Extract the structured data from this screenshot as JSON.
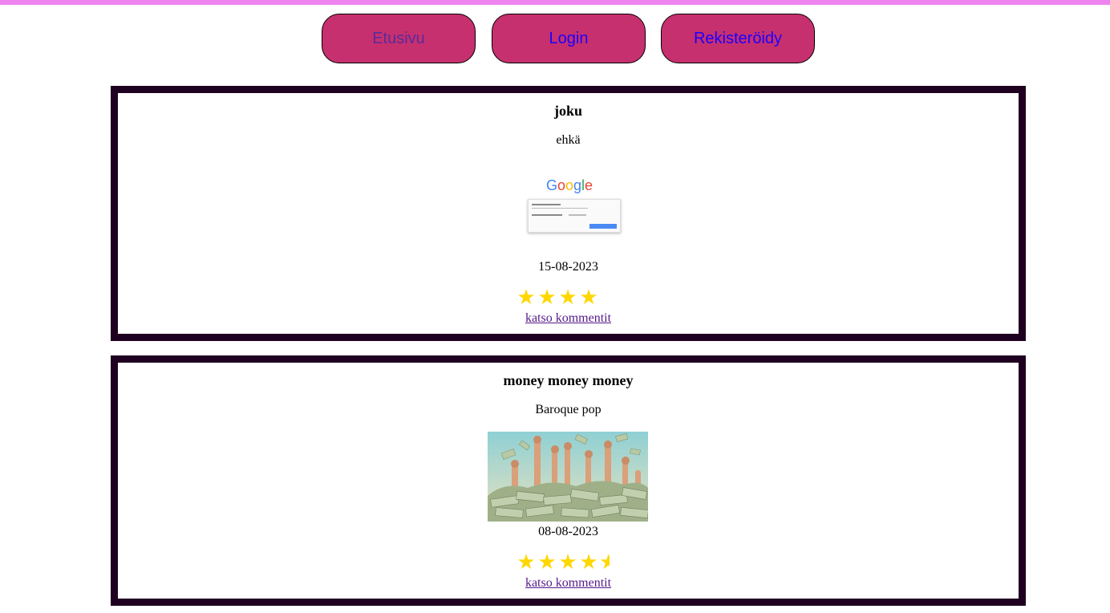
{
  "nav": {
    "home_label": "Etusivu",
    "login_label": "Login",
    "register_label": "Rekisteröidy"
  },
  "colors": {
    "top_bar": "#ee82ee",
    "button_bg": "#c7306e",
    "card_border": "#200020",
    "star": "#ffd700"
  },
  "posts": [
    {
      "title": "joku",
      "description": "ehkä",
      "image": "google-screenshot-thumbnail",
      "image_text": "Google",
      "date": "15-08-2023",
      "rating": 4,
      "comments_link": "katso kommentit"
    },
    {
      "title": "money money money",
      "description": "Baroque pop",
      "image": "money-thumbs-up-photo",
      "date": "08-08-2023",
      "rating": 4.5,
      "comments_link": "katso kommentit"
    }
  ]
}
